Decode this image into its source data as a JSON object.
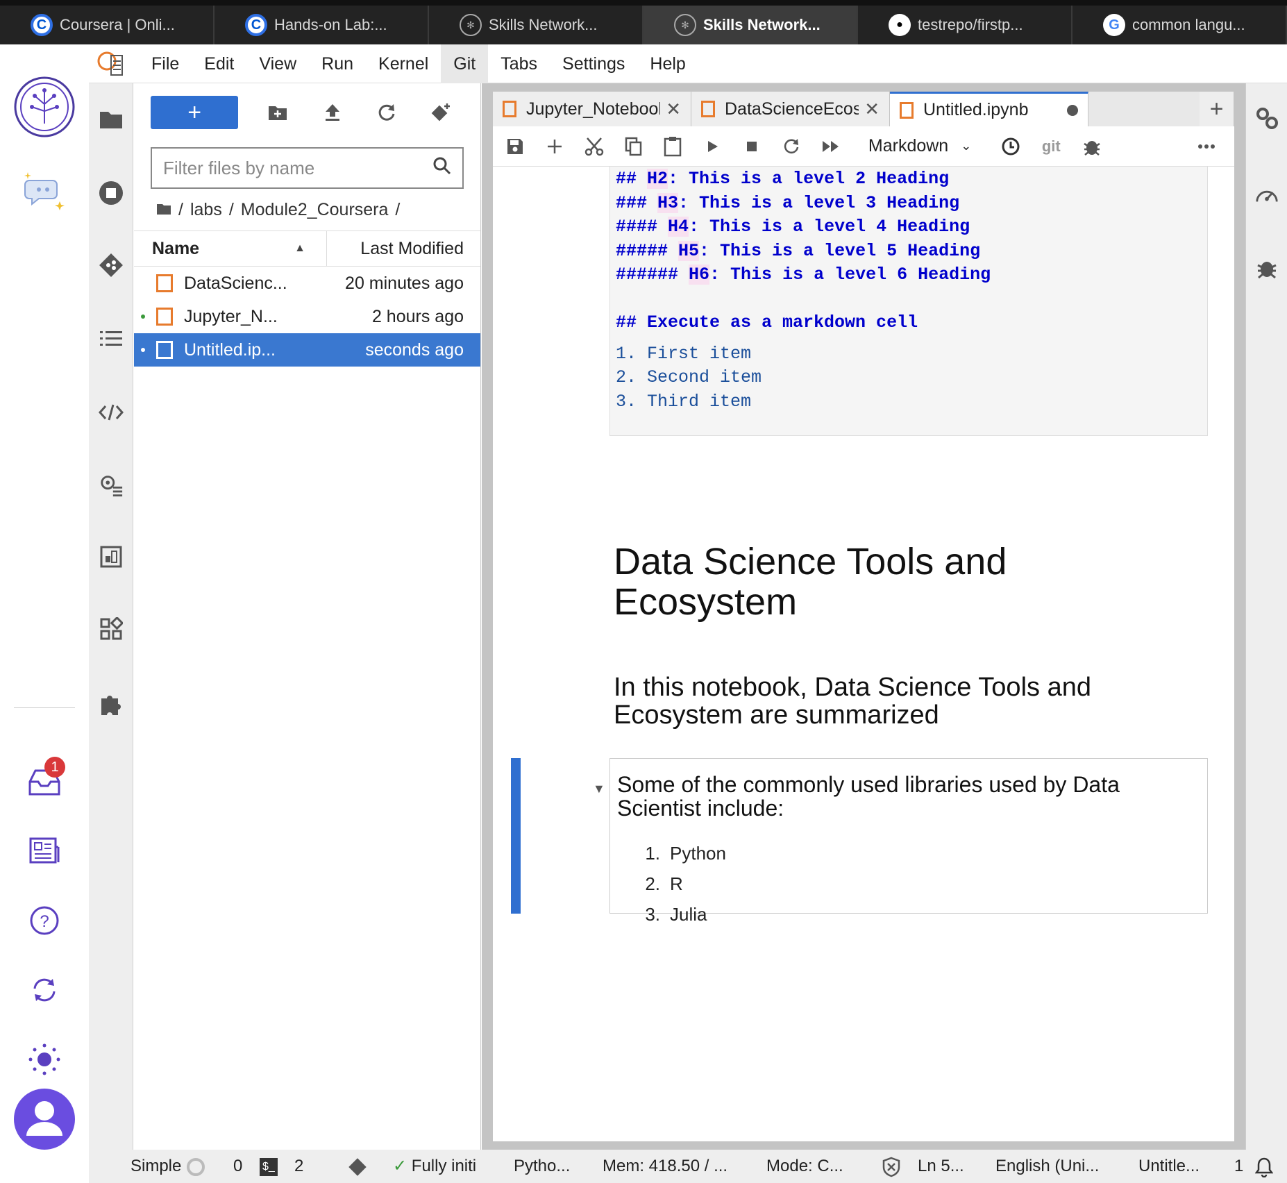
{
  "browser_tabs": [
    {
      "label": "Coursera | Onli...",
      "icon": "coursera-icon",
      "active": false
    },
    {
      "label": "Hands-on Lab:...",
      "icon": "coursera-icon",
      "active": false
    },
    {
      "label": "Skills Network...",
      "icon": "skills-network-icon",
      "active": false
    },
    {
      "label": "Skills Network...",
      "icon": "skills-network-icon",
      "active": true
    },
    {
      "label": "testrepo/firstp...",
      "icon": "github-icon",
      "active": false
    },
    {
      "label": "common langu...",
      "icon": "google-icon",
      "active": false
    }
  ],
  "menu": {
    "items": [
      "File",
      "Edit",
      "View",
      "Run",
      "Kernel",
      "Git",
      "Tabs",
      "Settings",
      "Help"
    ],
    "active": "Git"
  },
  "file_browser": {
    "new_label": "+",
    "filter_placeholder": "Filter files by name",
    "breadcrumb": [
      "/",
      "labs",
      "/",
      "Module2_Coursera",
      "/"
    ],
    "columns": {
      "name": "Name",
      "modified": "Last Modified"
    },
    "files": [
      {
        "name": "DataScienc...",
        "modified": "20 minutes ago",
        "running": false,
        "selected": false
      },
      {
        "name": "Jupyter_N...",
        "modified": "2 hours ago",
        "running": true,
        "selected": false
      },
      {
        "name": "Untitled.ip...",
        "modified": "seconds ago",
        "running": true,
        "selected": true
      }
    ]
  },
  "doc_tabs": [
    {
      "label": "Jupyter_Notebook.ip",
      "active": false
    },
    {
      "label": "DataScienceEcosyste",
      "active": false
    },
    {
      "label": "Untitled.ipynb",
      "active": true
    }
  ],
  "notebook_toolbar": {
    "cell_type": "Markdown",
    "git_label": "git"
  },
  "notebook": {
    "code_lines": [
      {
        "prefix": "## ",
        "tag": "H2",
        "rest": ": This is a level 2 Heading"
      },
      {
        "prefix": "### ",
        "tag": "H3",
        "rest": ": This is a level 3 Heading"
      },
      {
        "prefix": "#### ",
        "tag": "H4",
        "rest": ": This is a level 4 Heading"
      },
      {
        "prefix": "##### ",
        "tag": "H5",
        "rest": ": This is a level 5 Heading"
      },
      {
        "prefix": "###### ",
        "tag": "H6",
        "rest": ": This is a level 6 Heading"
      }
    ],
    "execute_heading": "## Execute as a markdown cell",
    "code_list": [
      "1. First item",
      "2. Second item",
      "3. Third item"
    ],
    "title": "Data Science Tools and Ecosystem",
    "subtitle": "In this notebook, Data Science Tools and Ecosystem are summarized",
    "active_cell_text": "Some of the commonly used libraries used by Data Scientist include:",
    "active_cell_list": [
      {
        "num": "1.",
        "text": "Python"
      },
      {
        "num": "2.",
        "text": "R"
      },
      {
        "num": "3.",
        "text": "Julia"
      }
    ]
  },
  "notification_count": "1",
  "status_bar": {
    "mode_toggle": "Simple",
    "kernels": "0",
    "terminals": "2",
    "terminal_icon_text": "$_",
    "kernel_status": "Fully initi",
    "kernel_name": "Pytho...",
    "memory": "Mem: 418.50 / ...",
    "mode": "Mode: C...",
    "line": "Ln 5...",
    "language": "English (Uni...",
    "file": "Untitle...",
    "count": "1"
  },
  "colors": {
    "accent": "#2f6fd0",
    "skills_purple": "#5a3fc0",
    "notebook_orange": "#e77b2d",
    "markdown_heading": "#0000cc"
  }
}
